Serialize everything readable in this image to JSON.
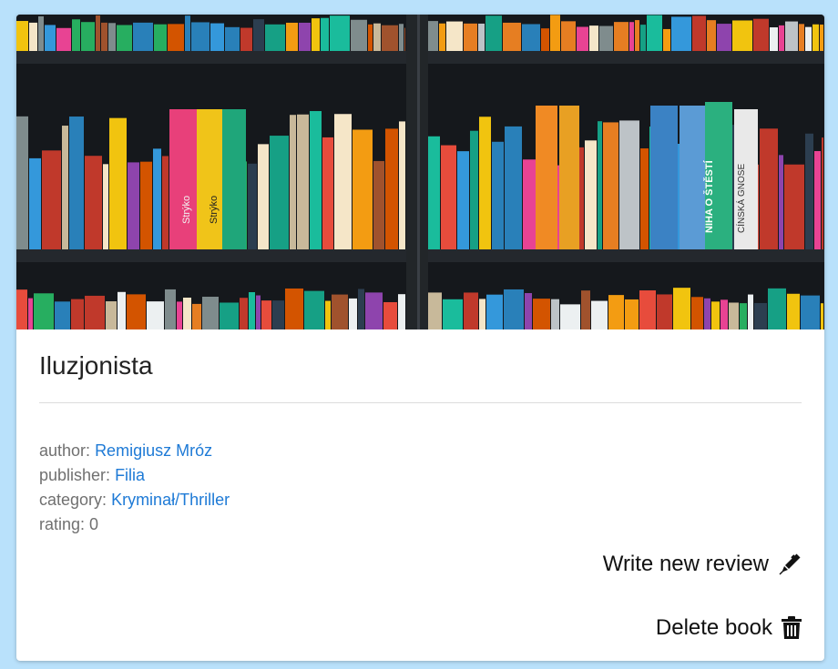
{
  "book": {
    "title": "Iluzjonista",
    "author_label": "author:",
    "author": "Remigiusz Mróz",
    "publisher_label": "publisher:",
    "publisher": "Filia",
    "category_label": "category:",
    "category": "Kryminał/Thriller",
    "rating_label": "rating:",
    "rating": "0"
  },
  "actions": {
    "write_review_label": "Write new review",
    "write_review_icon": "pen-icon",
    "delete_label": "Delete book",
    "delete_icon": "trash-icon"
  },
  "cover": {
    "image": "bookshelf-photo",
    "spine_texts": [
      "Strýko",
      "Strýko",
      "NIHA O ŠTĚSTÍ",
      "CÍNSKÁ GNOSE"
    ]
  },
  "colors": {
    "background": "#b9e1fb",
    "link": "#1e7ad6",
    "muted_text": "#707070"
  }
}
